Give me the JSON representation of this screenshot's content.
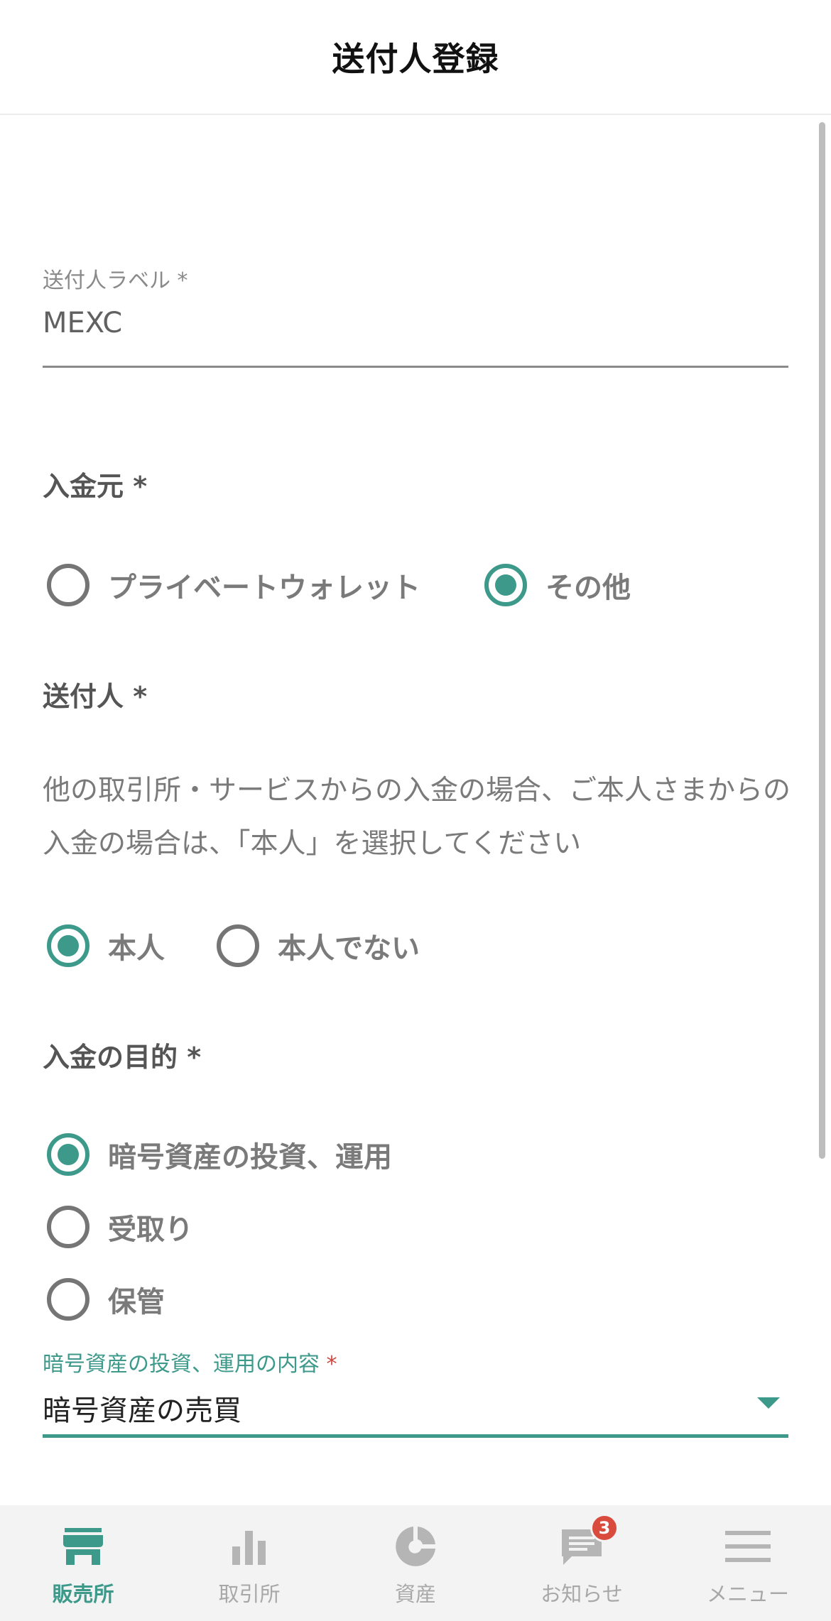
{
  "header": {
    "title": "送付人登録"
  },
  "form": {
    "sender_label": {
      "label": "送付人ラベル *",
      "value": "MEXC"
    },
    "source": {
      "title": "入金元 *",
      "options": [
        {
          "label": "プライベートウォレット",
          "checked": false
        },
        {
          "label": "その他",
          "checked": true
        }
      ]
    },
    "sender": {
      "title": "送付人 *",
      "note": "他の取引所・サービスからの入金の場合、ご本人さまからの入金の場合は、「本人」を選択してください",
      "options": [
        {
          "label": "本人",
          "checked": true
        },
        {
          "label": "本人でない",
          "checked": false
        }
      ]
    },
    "purpose": {
      "title": "入金の目的 *",
      "options": [
        {
          "label": "暗号資産の投資、運用",
          "checked": true
        },
        {
          "label": "受取り",
          "checked": false
        },
        {
          "label": "保管",
          "checked": false
        }
      ]
    },
    "purpose_detail": {
      "label": "暗号資産の投資、運用の内容",
      "required_mark": "*",
      "value": "暗号資産の売買"
    }
  },
  "bottom_nav": {
    "items": [
      {
        "label": "販売所",
        "icon": "store-icon",
        "active": true
      },
      {
        "label": "取引所",
        "icon": "bar-chart-icon",
        "active": false
      },
      {
        "label": "資産",
        "icon": "pie-chart-icon",
        "active": false
      },
      {
        "label": "お知らせ",
        "icon": "message-icon",
        "active": false,
        "badge": "3"
      },
      {
        "label": "メニュー",
        "icon": "menu-icon",
        "active": false
      }
    ]
  },
  "colors": {
    "accent": "#3d9a8b",
    "badge": "#d94c3d",
    "inactive": "#a8a8a8"
  }
}
